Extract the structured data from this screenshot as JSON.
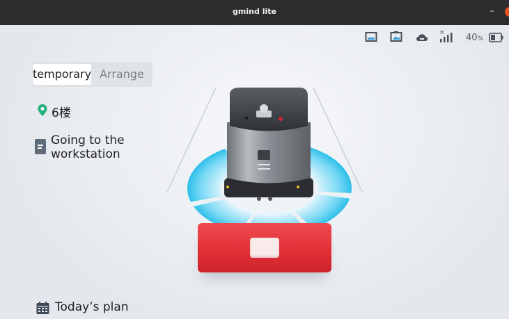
{
  "window": {
    "title": "gmind lite",
    "minimize_label": "–"
  },
  "status": {
    "icons": [
      "screen-icon",
      "screen-image-icon",
      "cloud-icon",
      "signal-icon",
      "battery-icon"
    ],
    "battery_value": "40",
    "battery_unit": "%"
  },
  "mode_toggle": {
    "options": [
      "temporary",
      "Arrange"
    ],
    "selected": "temporary"
  },
  "location": {
    "floor": "6楼"
  },
  "task": {
    "text": "Going to the workstation"
  },
  "plan": {
    "label": "Today’s plan"
  },
  "colors": {
    "accent": "#e0343a",
    "pin": "#21b07a",
    "ring": "#34c4ee",
    "titlebar": "#2c2c2c"
  }
}
